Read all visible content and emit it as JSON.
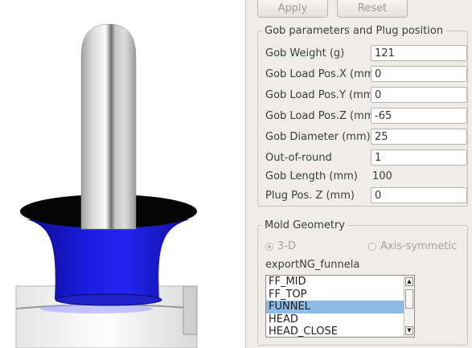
{
  "toolbar": {
    "apply_label": "Apply",
    "reset_label": "Reset"
  },
  "gob_group": {
    "title": "Gob parameters and Plug position",
    "rows": [
      {
        "label": "Gob Weight (g)",
        "value": "121"
      },
      {
        "label": "Gob Load Pos.X (mm)",
        "value": "0"
      },
      {
        "label": "Gob Load Pos.Y (mm)",
        "value": "0"
      },
      {
        "label": "Gob Load Pos.Z (mm)",
        "value": "-65"
      },
      {
        "label": "Gob Diameter (mm)",
        "value": "25"
      },
      {
        "label": "Out-of-round",
        "value": "1"
      },
      {
        "label": "Gob Length (mm)",
        "value": "100"
      },
      {
        "label": "Plug Pos. Z (mm)",
        "value": "0"
      }
    ]
  },
  "mold_group": {
    "title": "Mold Geometry",
    "radio_3d": "3-D",
    "radio_axis": "Axis-symmetic",
    "selected_radio": "3-D",
    "file_name": "exportNG_funnela",
    "list_items": [
      "FF_MID",
      "FF_TOP",
      "FUNNEL",
      "HEAD",
      "HEAD_CLOSE"
    ],
    "selected_item": "FUNNEL"
  },
  "viewport": {
    "colors": {
      "funnel": "#1a1ad6",
      "plunger": "#d4d4d4",
      "funnel_rim": "#050505",
      "base": "#f0f0f0"
    }
  }
}
